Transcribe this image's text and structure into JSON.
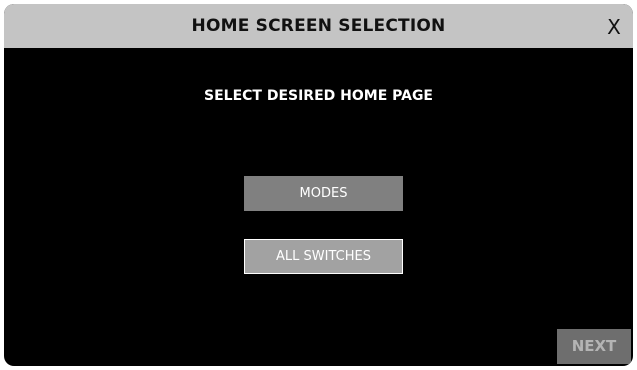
{
  "dialog": {
    "title": "HOME SCREEN SELECTION",
    "close_label": "X",
    "prompt": "SELECT DESIRED HOME PAGE",
    "options": [
      {
        "label": "MODES",
        "selected": false
      },
      {
        "label": "ALL SWITCHES",
        "selected": true
      }
    ],
    "next_label": "NEXT"
  },
  "colors": {
    "titlebar": "#c4c4c4",
    "background": "#000000",
    "option": "#808080",
    "option_selected": "#a2a2a2",
    "next": "#6e6e6e"
  }
}
